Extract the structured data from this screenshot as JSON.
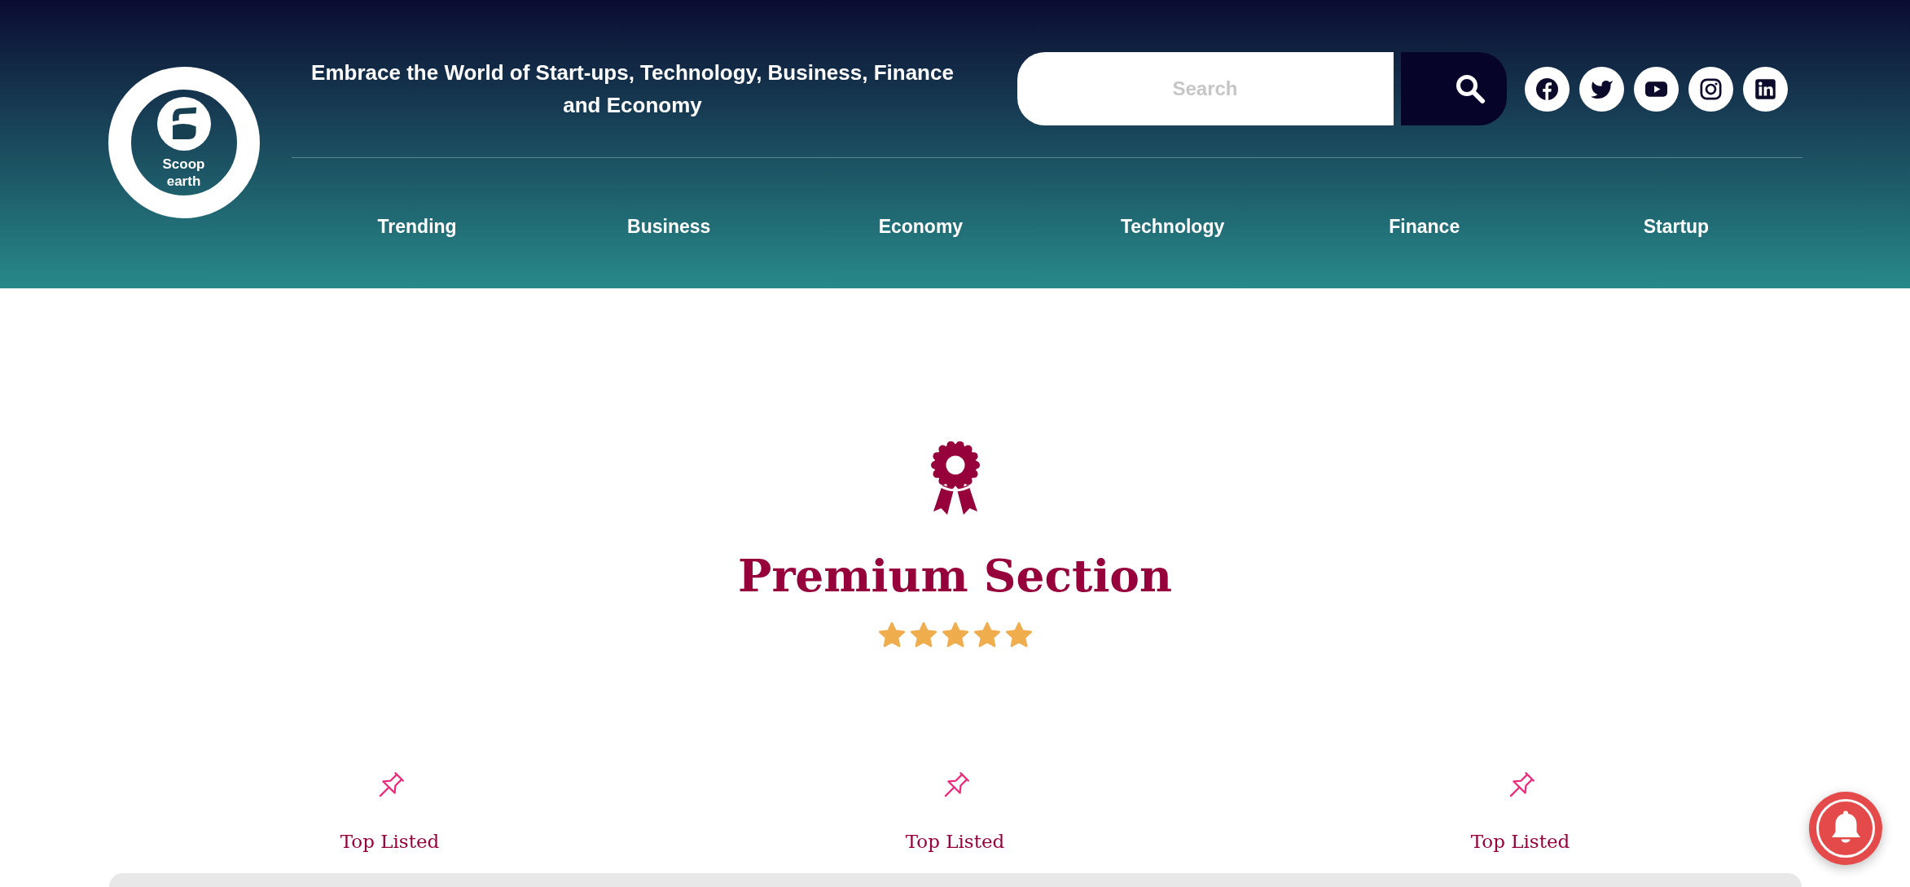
{
  "header": {
    "logo": {
      "text": "Scoop earth"
    },
    "tagline": "Embrace the World of Start-ups, Technology, Business, Finance and Economy",
    "search": {
      "placeholder": "Search"
    },
    "social_links": [
      {
        "kind": "facebook"
      },
      {
        "kind": "twitter"
      },
      {
        "kind": "youtube"
      },
      {
        "kind": "instagram"
      },
      {
        "kind": "linkedin"
      }
    ],
    "nav": [
      "Trending",
      "Business",
      "Economy",
      "Technology",
      "Finance",
      "Startup"
    ]
  },
  "premium": {
    "title": "Premium Section",
    "stars": 5
  },
  "columns": [
    {
      "label": "Top Listed"
    },
    {
      "label": "Top Listed"
    },
    {
      "label": "Top Listed"
    }
  ]
}
